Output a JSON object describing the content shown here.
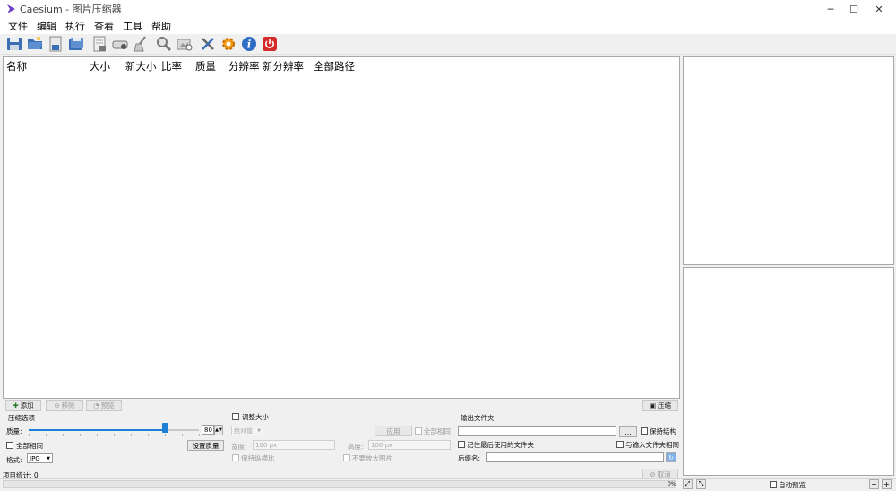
{
  "window": {
    "title": "Caesium - 图片压缩器"
  },
  "menu": [
    "文件",
    "编辑",
    "执行",
    "查看",
    "工具",
    "帮助"
  ],
  "list": {
    "columns": [
      "名称",
      "大小",
      "新大小",
      "比率",
      "质量",
      "分辨率",
      "新分辨率",
      "全部路径"
    ]
  },
  "list_buttons": {
    "add": "添加",
    "remove": "移除",
    "preview": "预览",
    "compress": "压缩"
  },
  "compression": {
    "group_title": "压缩选项",
    "quality_label": "质量:",
    "quality_value": "80",
    "quality_fraction": 0.8,
    "same_all_label": "全部相同",
    "set_quality_button": "设置质量",
    "format_label": "格式:",
    "format_value": "JPG"
  },
  "resize": {
    "checkbox_label": "调整大小",
    "mode_value": "绝对值",
    "apply_button": "应用",
    "same_all_label": "全部相同",
    "width_label": "宽度:",
    "width_value": "100 px",
    "height_label": "高度:",
    "height_value": "100 px",
    "keep_ratio_label": "保持纵横比",
    "no_enlarge_label": "不要放大图片"
  },
  "output": {
    "group_title": "输出文件夹",
    "path_value": "",
    "browse_button": "...",
    "keep_structure_label": "保持结构",
    "remember_last_label": "记住最后使用的文件夹",
    "same_as_input_label": "与输入文件夹相同",
    "suffix_label": "后缀名:",
    "suffix_value": ""
  },
  "footer": {
    "item_stats": "项目统计: 0",
    "cancel_button": "取消",
    "progress_text": "0%",
    "auto_preview_label": "自动预览"
  }
}
